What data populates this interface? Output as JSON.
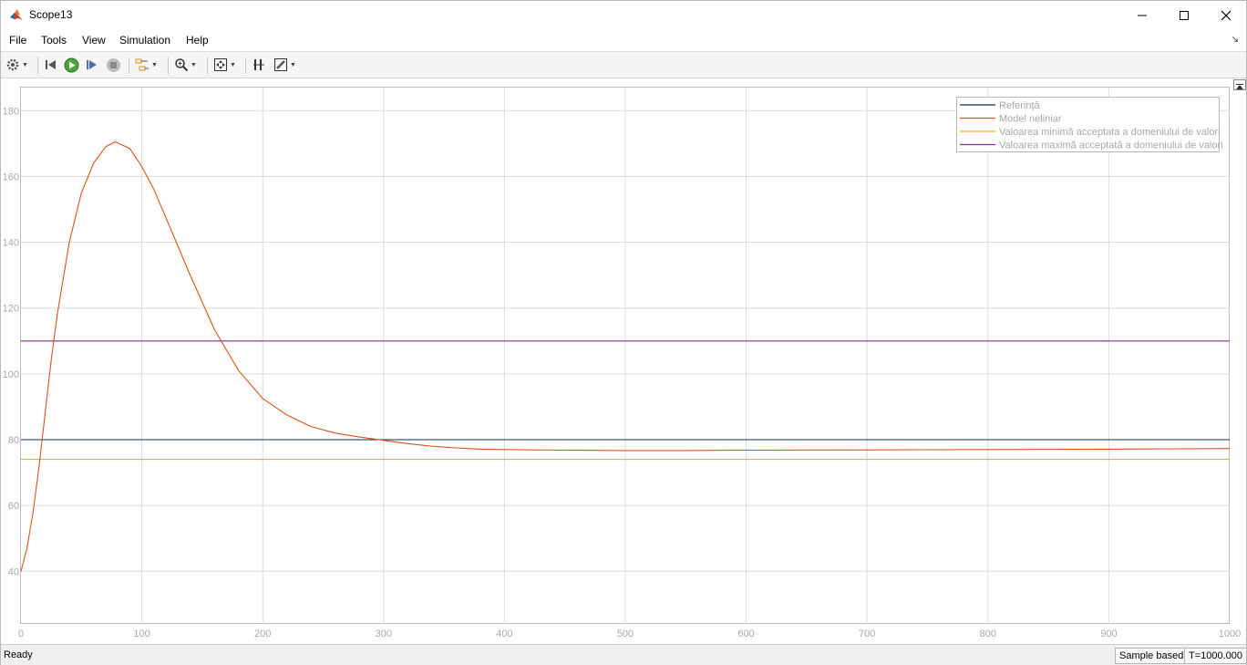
{
  "window": {
    "title": "Scope13"
  },
  "menu": [
    "File",
    "Tools",
    "View",
    "Simulation",
    "Help"
  ],
  "toolbar": {
    "icons": [
      "gear-icon",
      "step-back-icon",
      "run-icon",
      "step-forward-icon",
      "stop-icon",
      "signal-select-icon",
      "zoom-in-icon",
      "fit-to-view-icon",
      "cursor-measure-icon",
      "style-icon"
    ]
  },
  "status": {
    "left": "Ready",
    "mode": "Sample based",
    "time": "T=1000.000"
  },
  "colors": {
    "referinta": "#0b2c5f",
    "model": "#d95319",
    "min": "#edb120",
    "max": "#7e2f8e",
    "grid": "#dcdcdc",
    "tick_text": "#a8a8a8"
  },
  "chart_data": {
    "type": "line",
    "title": "",
    "xlabel": "",
    "ylabel": "",
    "xlim": [
      0,
      1000
    ],
    "ylim": [
      24,
      187
    ],
    "xticks": [
      0,
      100,
      200,
      300,
      400,
      500,
      600,
      700,
      800,
      900,
      1000
    ],
    "yticks": [
      40,
      60,
      80,
      100,
      120,
      140,
      160,
      180
    ],
    "grid": true,
    "legend_position": "top-right",
    "series": [
      {
        "name": "Referință",
        "color": "#0b2c5f",
        "x": [
          0,
          1000
        ],
        "y": [
          80,
          80
        ]
      },
      {
        "name": "Model neliniar",
        "color": "#d95319",
        "x": [
          0,
          5,
          10,
          15,
          20,
          25,
          30,
          40,
          50,
          60,
          70,
          78,
          90,
          100,
          110,
          125,
          140,
          160,
          180,
          200,
          220,
          240,
          260,
          280,
          300,
          320,
          340,
          360,
          380,
          400,
          450,
          500,
          550,
          600,
          700,
          800,
          900,
          1000
        ],
        "y": [
          40,
          47,
          58,
          72,
          88,
          104,
          118,
          140,
          155,
          164,
          169,
          170.5,
          168.5,
          163,
          156,
          143,
          130,
          113.5,
          101,
          92.5,
          87.5,
          84,
          82,
          80.8,
          79.8,
          78.8,
          78,
          77.5,
          77.1,
          77,
          76.8,
          76.7,
          76.7,
          76.8,
          76.9,
          77,
          77.1,
          77.3
        ]
      },
      {
        "name": "Valoarea minimă acceptata a domeniului de valori",
        "color": "#edb120",
        "x": [
          0,
          1000
        ],
        "y": [
          74,
          74
        ]
      },
      {
        "name": "Valoarea maximă acceptată a domeniului de valori",
        "color": "#7e2f8e",
        "x": [
          0,
          1000
        ],
        "y": [
          110,
          110
        ]
      }
    ]
  }
}
